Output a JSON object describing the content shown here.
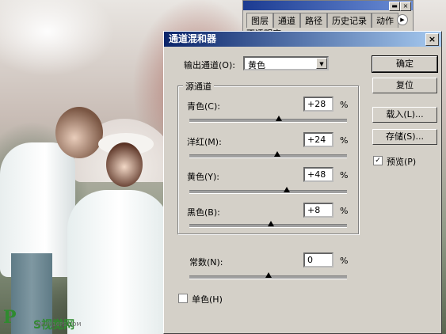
{
  "panel": {
    "tabs": [
      "图层",
      "通道",
      "路径",
      "历史记录",
      "动作"
    ],
    "row_text": "不透明度"
  },
  "dialog": {
    "title": "通道混和器",
    "close_label": "×",
    "output_channel_label": "输出通道(O):",
    "output_channel_value": "黄色",
    "source_group_label": "源通道",
    "channels": [
      {
        "label": "青色(C):",
        "value": "+28",
        "unit": "%",
        "slider_pct": 0.57
      },
      {
        "label": "洋红(M):",
        "value": "+24",
        "unit": "%",
        "slider_pct": 0.56
      },
      {
        "label": "黄色(Y):",
        "value": "+48",
        "unit": "%",
        "slider_pct": 0.62
      },
      {
        "label": "黑色(B):",
        "value": "+8",
        "unit": "%",
        "slider_pct": 0.52
      }
    ],
    "constant": {
      "label": "常数(N):",
      "value": "0",
      "unit": "%",
      "slider_pct": 0.5
    },
    "monochrome_label": "单色(H)",
    "monochrome_checked": false,
    "buttons": {
      "ok": "确定",
      "reset": "复位",
      "load": "载入(L)...",
      "save": "存储(S)..."
    },
    "preview_label": "预览(P)",
    "preview_checked": true
  },
  "watermark": {
    "logo": "P",
    "text": "S视觉网",
    "url": "WWW.16PS.COM"
  }
}
